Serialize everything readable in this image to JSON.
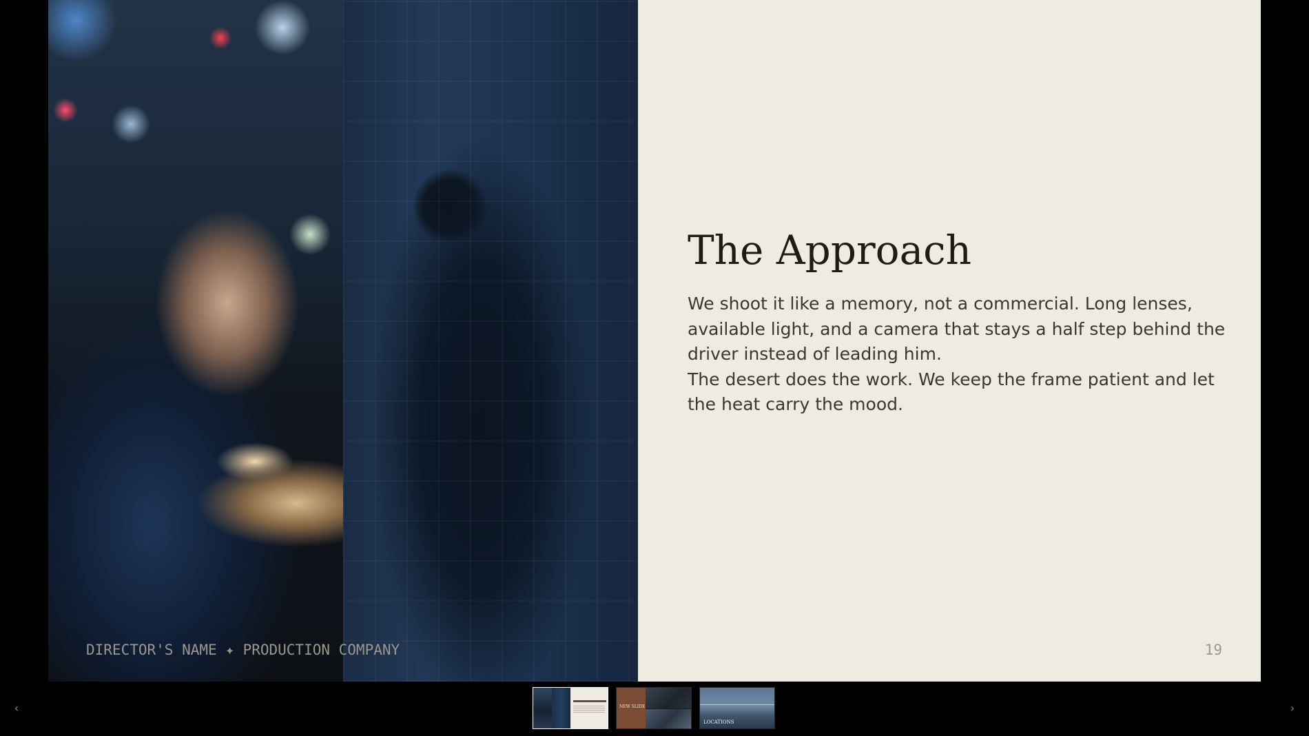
{
  "slide": {
    "title": "The Approach",
    "paragraphs": [
      "We shoot it like a memory, not a commercial. Long lenses, available light, and a camera that stays a half step behind the driver instead of leading him.",
      "The desert does the work. We keep the frame patient and let the heat carry the mood."
    ],
    "footer_credit": "DIRECTOR'S NAME ✦ PRODUCTION COMPANY",
    "page_number": "19"
  },
  "thumbnails": [
    {
      "label": "The Approach",
      "selected": true
    },
    {
      "label": "NEW SLIDE",
      "selected": false
    },
    {
      "label": "LOCATIONS",
      "selected": false
    }
  ],
  "navigation": {
    "prev_icon": "‹",
    "next_icon": "›"
  },
  "colors": {
    "background": "#000000",
    "slide_panel": "#efebe1",
    "title_text": "#1f1c18",
    "body_text": "#3a3630",
    "muted_text": "#9c978d",
    "thumb_selected_border": "#ffffff"
  }
}
